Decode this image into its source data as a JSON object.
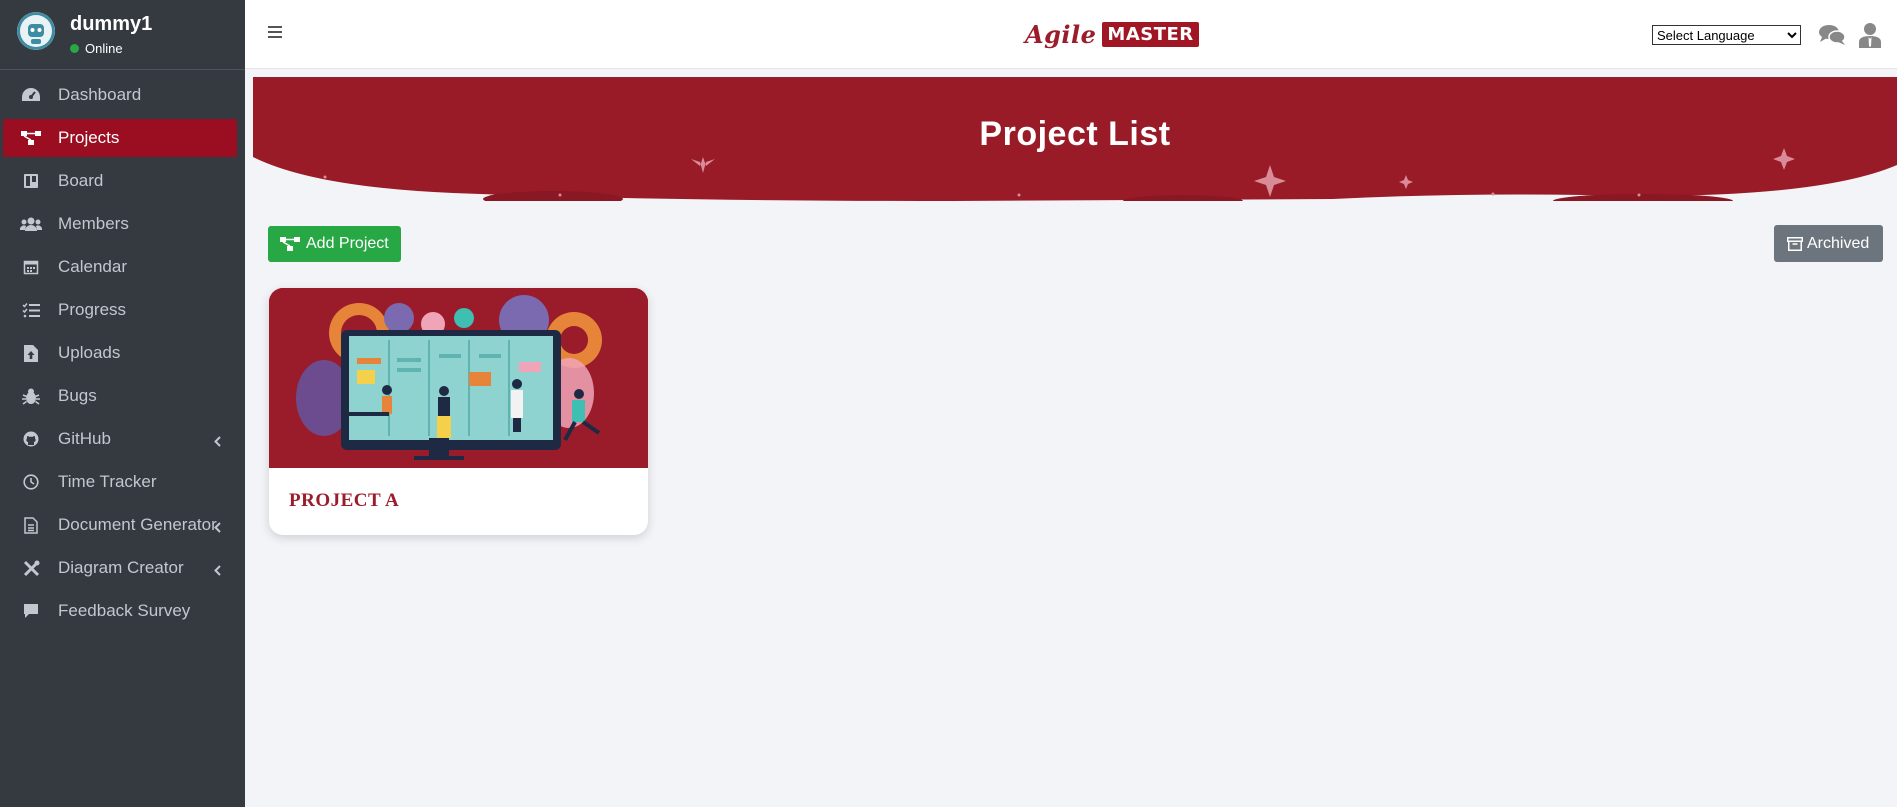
{
  "sidebar": {
    "user": {
      "name": "dummy1",
      "status": "Online"
    },
    "items": [
      {
        "label": "Dashboard",
        "icon": "dashboard-icon"
      },
      {
        "label": "Projects",
        "icon": "project-diagram-icon",
        "active": true
      },
      {
        "label": "Board",
        "icon": "board-icon"
      },
      {
        "label": "Members",
        "icon": "members-icon"
      },
      {
        "label": "Calendar",
        "icon": "calendar-icon"
      },
      {
        "label": "Progress",
        "icon": "tasks-icon"
      },
      {
        "label": "Uploads",
        "icon": "file-upload-icon"
      },
      {
        "label": "Bugs",
        "icon": "bug-icon"
      },
      {
        "label": "GitHub",
        "icon": "github-icon",
        "expandable": true
      },
      {
        "label": "Time Tracker",
        "icon": "clock-icon"
      },
      {
        "label": "Document Generator",
        "icon": "document-icon",
        "expandable": true
      },
      {
        "label": "Diagram Creator",
        "icon": "tools-icon",
        "expandable": true
      },
      {
        "label": "Feedback Survey",
        "icon": "comment-icon"
      }
    ]
  },
  "header": {
    "logo_script": "Agile",
    "logo_block": "MASTER",
    "language_select": "Select Language"
  },
  "page": {
    "title": "Project List",
    "add_button": "Add Project",
    "archived_button": "Archived"
  },
  "projects": [
    {
      "name": "PROJECT A"
    }
  ],
  "colors": {
    "accent": "#9b0e22",
    "sidebar": "#343a40",
    "success": "#28a745",
    "secondary": "#6c757d",
    "hero": "#991b27"
  }
}
